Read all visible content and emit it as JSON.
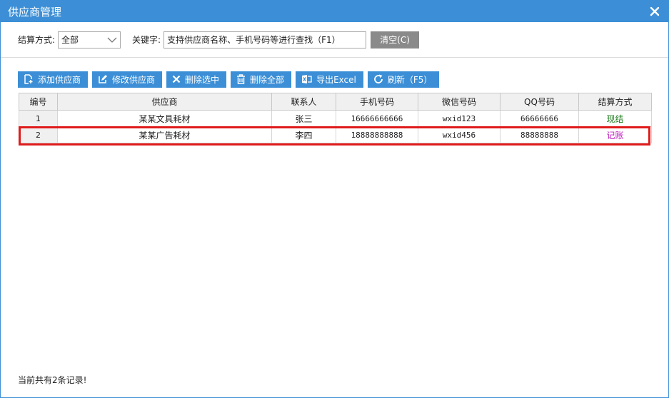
{
  "window": {
    "title": "供应商管理"
  },
  "filter": {
    "settle_label": "结算方式:",
    "settle_value": "全部",
    "keyword_label": "关键字:",
    "keyword_value": "支持供应商名称、手机号码等进行查找（F1）",
    "clear_label": "清空(C)"
  },
  "toolbar": {
    "add": "添加供应商",
    "edit": "修改供应商",
    "delete_selected": "删除选中",
    "delete_all": "删除全部",
    "export": "导出Excel",
    "refresh": "刷新（F5）"
  },
  "table": {
    "headers": [
      "编号",
      "供应商",
      "联系人",
      "手机号码",
      "微信号码",
      "QQ号码",
      "结算方式"
    ],
    "rows": [
      [
        "1",
        "某某文具耗材",
        "张三",
        "16666666666",
        "wxid123",
        "66666666",
        "现结"
      ],
      [
        "2",
        "某某广告耗材",
        "李四",
        "18888888888",
        "wxid456",
        "88888888",
        "记账"
      ]
    ]
  },
  "colors": {
    "accent": "#3c8fd6",
    "settle_cash": "#1a7a1a",
    "settle_credit": "#c020c0",
    "highlight": "#e01b1b"
  },
  "status": {
    "text": "当前共有2条记录!"
  }
}
